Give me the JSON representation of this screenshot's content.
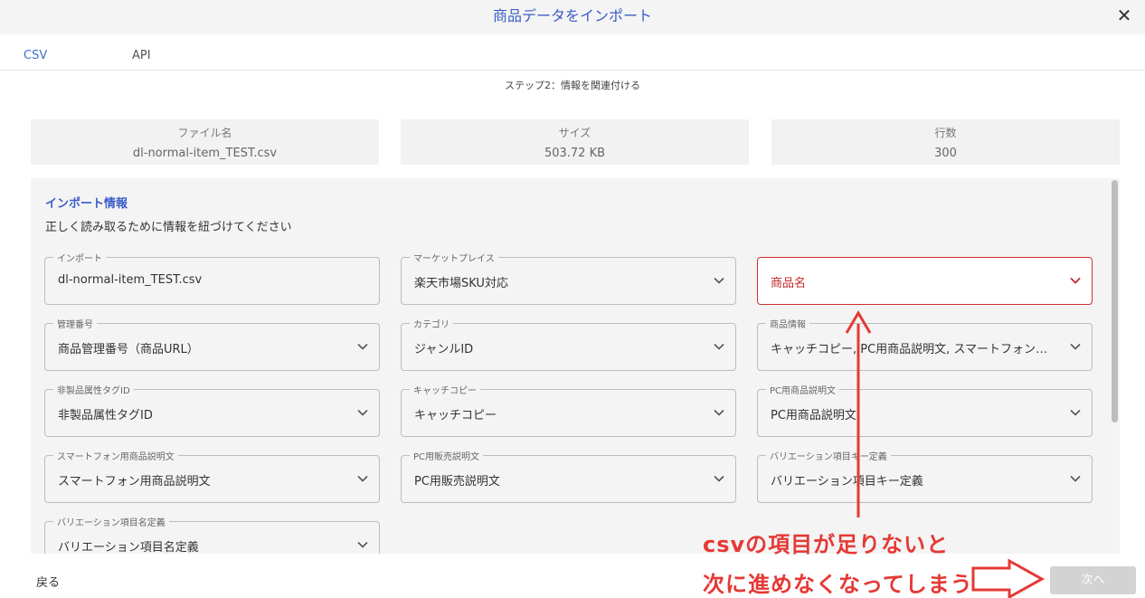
{
  "dialog": {
    "title": "商品データをインポート",
    "close_icon": "✕"
  },
  "tabs": [
    {
      "label": "CSV",
      "active": true
    },
    {
      "label": "API",
      "active": false
    }
  ],
  "step": "ステップ2：情報を関連付ける",
  "file_info": {
    "filename": {
      "label": "ファイル名",
      "value": "dl-normal-item_TEST.csv"
    },
    "size": {
      "label": "サイズ",
      "value": "503.72 KB"
    },
    "rows": {
      "label": "行数",
      "value": "300"
    }
  },
  "section": {
    "title": "インポート情報",
    "description": "正しく読み取るために情報を紐づけてください"
  },
  "fields": {
    "import": {
      "label": "インポート",
      "value": "dl-normal-item_TEST.csv"
    },
    "marketplace": {
      "label": "マーケットプレイス",
      "value": "楽天市場SKU対応"
    },
    "product_name": {
      "label": "",
      "value": "商品名"
    },
    "mgmt_no": {
      "label": "管理番号",
      "value": "商品管理番号（商品URL）"
    },
    "category": {
      "label": "カテゴリ",
      "value": "ジャンルID"
    },
    "product_info": {
      "label": "商品情報",
      "value": "キャッチコピー, PC用商品説明文, スマートフォン用商品説明文"
    },
    "non_product_tag": {
      "label": "非製品属性タグID",
      "value": "非製品属性タグID"
    },
    "catch_copy": {
      "label": "キャッチコピー",
      "value": "キャッチコピー"
    },
    "pc_desc": {
      "label": "PC用商品説明文",
      "value": "PC用商品説明文"
    },
    "sp_desc": {
      "label": "スマートフォン用商品説明文",
      "value": "スマートフォン用商品説明文"
    },
    "pc_sales_desc": {
      "label": "PC用販売説明文",
      "value": "PC用販売説明文"
    },
    "variation_key": {
      "label": "バリエーション項目キー定義",
      "value": "バリエーション項目キー定義"
    },
    "variation_name": {
      "label": "バリエーション項目名定義",
      "value": "バリエーション項目名定義"
    }
  },
  "footer": {
    "back_label": "戻る",
    "next_label": "次へ"
  },
  "annotation": {
    "line1": "csvの項目が足りないと",
    "line2": "次に進めなくなってしまう",
    "color": "#e53935"
  },
  "colors": {
    "accent": "#3a5cc9",
    "error": "#d32f2f",
    "disabled_button": "#d3d3d3"
  }
}
